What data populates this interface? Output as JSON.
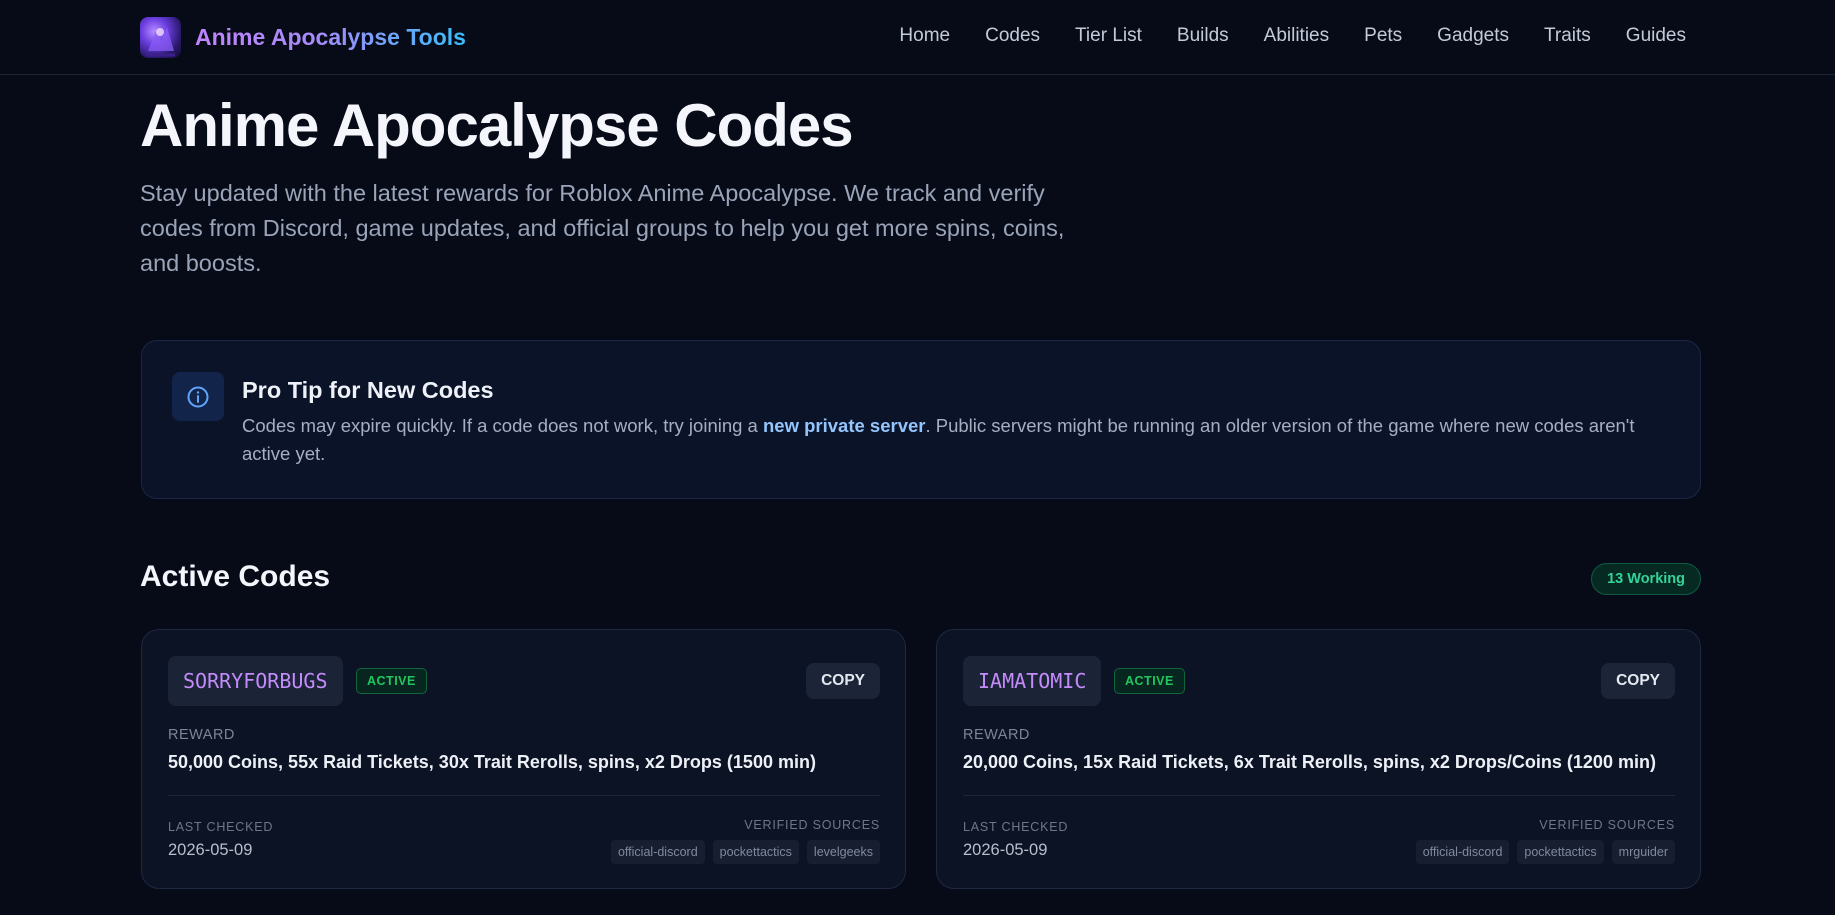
{
  "brand": {
    "name": "Anime Apocalypse Tools"
  },
  "nav": {
    "links": [
      "Home",
      "Codes",
      "Tier List",
      "Builds",
      "Abilities",
      "Pets",
      "Gadgets",
      "Traits",
      "Guides"
    ]
  },
  "hero": {
    "title": "Anime Apocalypse Codes",
    "subtitle": "Stay updated with the latest rewards for Roblox Anime Apocalypse. We track and verify codes from Discord, game updates, and official groups to help you get more spins, coins, and boosts."
  },
  "tip": {
    "title": "Pro Tip for New Codes",
    "body_before": "Codes may expire quickly. If a code does not work, try joining a ",
    "link": "new private server",
    "body_after": ". Public servers might be running an older version of the game where new codes aren't active yet."
  },
  "active": {
    "title": "Active Codes",
    "badge": "13 Working",
    "colors": {
      "badge": "#34d399",
      "code": "#c48bfb",
      "status": "#22c55e"
    },
    "cards": [
      {
        "code": "SORRYFORBUGS",
        "status": "ACTIVE",
        "copy": "COPY",
        "reward_label": "REWARD",
        "reward": "50,000 Coins, 55x Raid Tickets, 30x Trait Rerolls, spins, x2 Drops (1500 min)",
        "last_checked_label": "LAST CHECKED",
        "last_checked": "2026-05-09",
        "sources_label": "VERIFIED SOURCES",
        "sources": [
          "official-discord",
          "pockettactics",
          "levelgeeks"
        ]
      },
      {
        "code": "IAMATOMIC",
        "status": "ACTIVE",
        "copy": "COPY",
        "reward_label": "REWARD",
        "reward": "20,000 Coins, 15x Raid Tickets, 6x Trait Rerolls, spins, x2 Drops/Coins (1200 min)",
        "last_checked_label": "LAST CHECKED",
        "last_checked": "2026-05-09",
        "sources_label": "VERIFIED SOURCES",
        "sources": [
          "official-discord",
          "pockettactics",
          "mrguider"
        ]
      }
    ]
  }
}
